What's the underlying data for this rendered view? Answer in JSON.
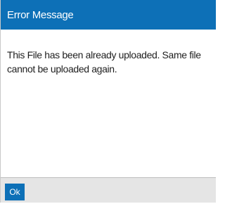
{
  "dialog": {
    "title": "Error Message",
    "message": "This File has been already uploaded. Same file cannot be uploaded again.",
    "ok_label": "Ok"
  },
  "colors": {
    "accent": "#0d70b7",
    "footer_bg": "#e5e5e5"
  }
}
